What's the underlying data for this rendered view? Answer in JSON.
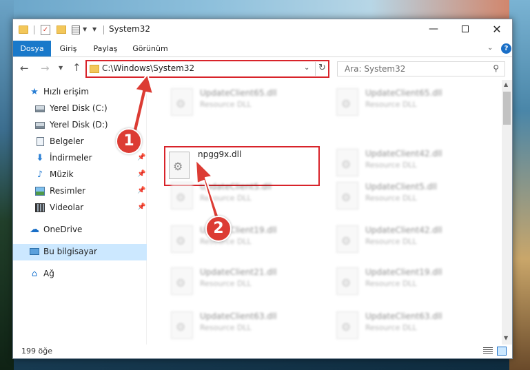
{
  "window": {
    "title": "System32"
  },
  "ribbon": {
    "tabs": [
      "Dosya",
      "Giriş",
      "Paylaş",
      "Görünüm"
    ],
    "help": "?"
  },
  "address": {
    "path": "C:\\Windows\\System32",
    "search_placeholder": "Ara: System32"
  },
  "sidebar": {
    "quick_access": "Hızlı erişim",
    "items": [
      {
        "label": "Yerel Disk (C:)",
        "icon": "drive-icon"
      },
      {
        "label": "Yerel Disk (D:)",
        "icon": "drive-icon"
      },
      {
        "label": "Belgeler",
        "icon": "documents-icon"
      },
      {
        "label": "İndirmeler",
        "icon": "downloads-icon"
      },
      {
        "label": "Müzik",
        "icon": "music-icon"
      },
      {
        "label": "Resimler",
        "icon": "pictures-icon"
      },
      {
        "label": "Videolar",
        "icon": "videos-icon"
      }
    ],
    "onedrive": "OneDrive",
    "this_pc": "Bu bilgisayar",
    "network": "Ağ"
  },
  "files": {
    "left_column": [
      {
        "name": "UpdateClient65.dll",
        "type": "Resource DLL"
      },
      {
        "name": "npgg9x.dll",
        "type": ""
      },
      {
        "name": "UpdateClient5.dll",
        "type": "Resource DLL"
      },
      {
        "name": "UpdateClient19.dll",
        "type": "Resource DLL"
      },
      {
        "name": "UpdateClient21.dll",
        "type": "Resource DLL"
      },
      {
        "name": "UpdateClient63.dll",
        "type": "Resource DLL"
      }
    ],
    "right_column": [
      {
        "name": "UpdateClient65.dll",
        "type": "Resource DLL"
      },
      {
        "name": "UpdateClient42.dll",
        "type": "Resource DLL"
      },
      {
        "name": "UpdateClient5.dll",
        "type": "Resource DLL"
      },
      {
        "name": "UpdateClient42.dll",
        "type": "Resource DLL"
      },
      {
        "name": "UpdateClient19.dll",
        "type": "Resource DLL"
      },
      {
        "name": "UpdateClient63.dll",
        "type": "Resource DLL"
      }
    ]
  },
  "status": {
    "count": "199 öğe"
  },
  "annotations": {
    "step1": "1",
    "step2": "2",
    "color": "#dc3c34"
  }
}
